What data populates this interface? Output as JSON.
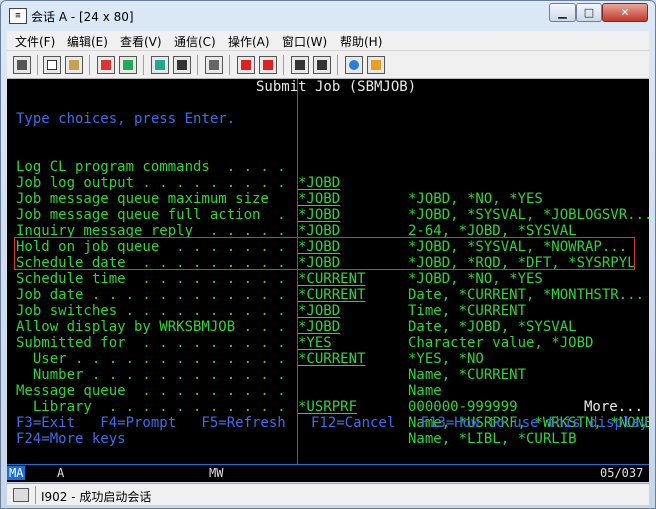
{
  "window": {
    "title": "会话 A - [24 x 80]",
    "min_glyph": "▁",
    "max_glyph": "□",
    "close_glyph": "✕"
  },
  "menu": [
    "文件(F)",
    "编辑(E)",
    "查看(V)",
    "通信(C)",
    "操作(A)",
    "窗口(W)",
    "帮助(H)"
  ],
  "toolbar_icons": [
    "print-icon",
    "copy-icon",
    "paste-icon",
    "send-icon",
    "receive-icon",
    "display-icon",
    "keypad-icon",
    "macro-icon",
    "record-icon",
    "stop-icon",
    "play-icon",
    "play-macro-icon",
    "globe-icon",
    "edit-icon"
  ],
  "screen": {
    "title": "Submit Job (SBMJOB)",
    "instruction": "Type choices, press Enter.",
    "fields": [
      {
        "label": "Log CL program commands  . . . .",
        "value": "*JOBD",
        "hint": "*JOBD, *NO, *YES"
      },
      {
        "label": "Job log output . . . . . . . . .",
        "value": "*JOBD",
        "hint": "*JOBD, *SYSVAL, *JOBLOGSVR..."
      },
      {
        "label": "Job message queue maximum size",
        "value": "*JOBD",
        "hint": "2-64, *JOBD, *SYSVAL"
      },
      {
        "label": "Job message queue full action  .",
        "value": "*JOBD",
        "hint": "*JOBD, *SYSVAL, *NOWRAP..."
      },
      {
        "label": "Inquiry message reply  . . . . .",
        "value": "*JOBD",
        "hint": "*JOBD, *RQD, *DFT, *SYSRPYL"
      },
      {
        "label": "Hold on job queue  . . . . . . .",
        "value": "*JOBD",
        "hint": "*JOBD, *NO, *YES"
      },
      {
        "label": "Schedule date  . . . . . . . . .",
        "value": "*CURRENT",
        "hint": "Date, *CURRENT, *MONTHSTR..."
      },
      {
        "label": "Schedule time  . . . . . . . . .",
        "value": "*CURRENT",
        "hint": "Time, *CURRENT"
      },
      {
        "label": "Job date . . . . . . . . . . . .",
        "value": "*JOBD",
        "hint": "Date, *JOBD, *SYSVAL"
      },
      {
        "label": "Job switches . . . . . . . . . .",
        "value": "*JOBD",
        "hint": "Character value, *JOBD"
      },
      {
        "label": "Allow display by WRKSBMJOB . . .",
        "value": "*YES",
        "hint": "*YES, *NO"
      },
      {
        "label": "Submitted for  . . . . . . . . .",
        "value": "*CURRENT",
        "hint": "Name, *CURRENT"
      },
      {
        "label": "  User . . . . . . . . . . . . .",
        "value": "",
        "hint": "Name"
      },
      {
        "label": "  Number . . . . . . . . . . . .",
        "value": "",
        "hint": "000000-999999"
      },
      {
        "label": "Message queue  . . . . . . . . .",
        "value": "*USRPRF",
        "hint": "Name, *USRPRF, *WRKSTN, *NONE"
      },
      {
        "label": "  Library  . . . . . . . . . . .",
        "value": "",
        "hint": "Name, *LIBL, *CURLIB"
      }
    ],
    "more": "More...",
    "fkeys_line1": "F3=Exit   F4=Prompt   F5=Refresh   F12=Cancel   F13=How to use this display",
    "fkeys_line2": "F24=More keys"
  },
  "oia": {
    "ma": "MA",
    "a": "A",
    "mw": "MW",
    "position": "05/037"
  },
  "status": {
    "message": "I902 - 成功启动会话"
  },
  "colors": {
    "text_green": "#2fd43a",
    "text_blue": "#3e6cf0",
    "highlight": "#d23b2a",
    "cursor": "#8a2be2"
  }
}
